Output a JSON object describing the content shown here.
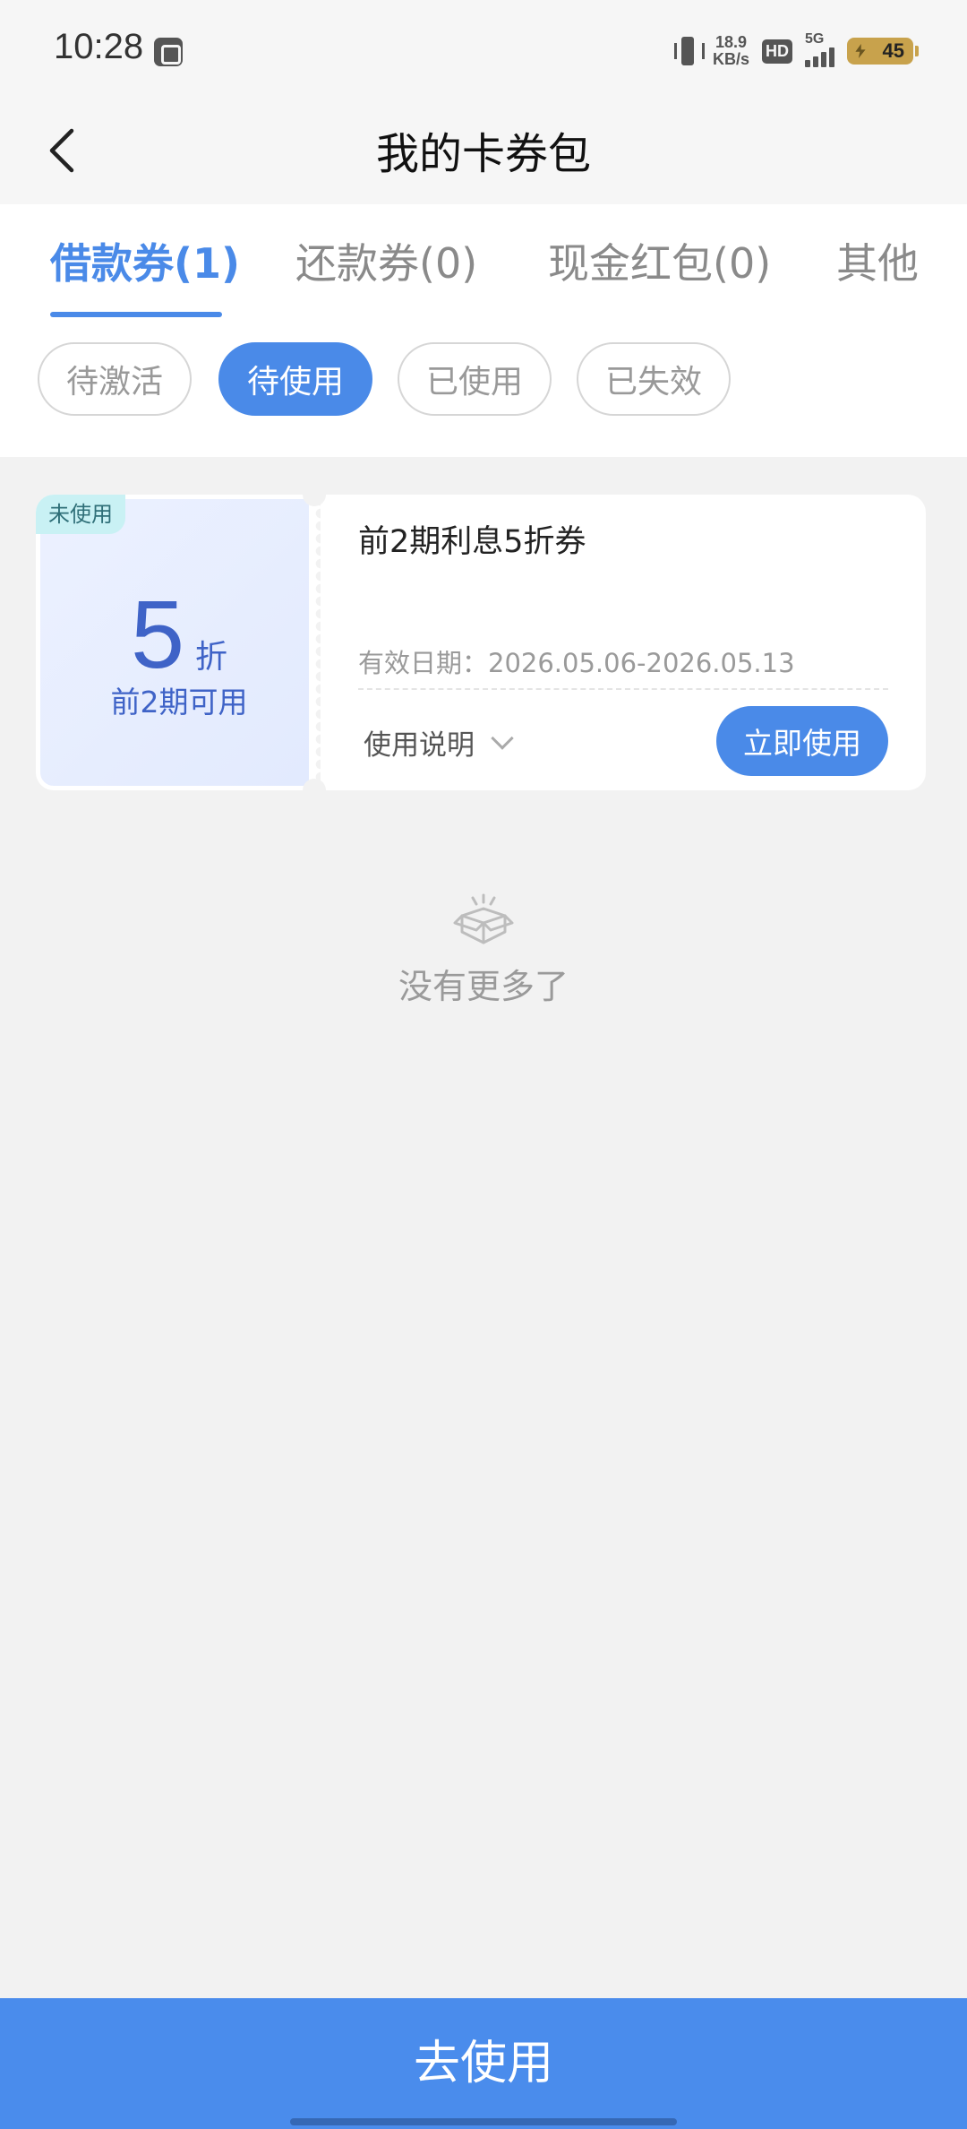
{
  "status_bar": {
    "time": "10:28",
    "net_speed_value": "18.9",
    "net_speed_unit": "KB/s",
    "hd_label": "HD",
    "network_label": "5G",
    "battery": "45"
  },
  "header": {
    "title": "我的卡券包"
  },
  "tabs": [
    {
      "label": "借款券(1)",
      "active": true
    },
    {
      "label": "还款券(0)",
      "active": false
    },
    {
      "label": "现金红包(0)",
      "active": false
    },
    {
      "label": "其他",
      "active": false
    }
  ],
  "filters": [
    {
      "label": "待激活",
      "active": false
    },
    {
      "label": "待使用",
      "active": true
    },
    {
      "label": "已使用",
      "active": false
    },
    {
      "label": "已失效",
      "active": false
    }
  ],
  "coupon": {
    "badge": "未使用",
    "value": "5",
    "unit": "折",
    "condition": "前2期可用",
    "title": "前2期利息5折券",
    "validity": "有效日期：2026.05.06-2026.05.13",
    "usage_label": "使用说明",
    "action_label": "立即使用"
  },
  "empty_state": {
    "text": "没有更多了"
  },
  "bottom_button": {
    "label": "去使用"
  },
  "colors": {
    "accent": "#4a8ae8",
    "coupon_value": "#3f63c7",
    "badge_bg": "#c9f1f4",
    "page_bg": "#f2f2f2"
  }
}
